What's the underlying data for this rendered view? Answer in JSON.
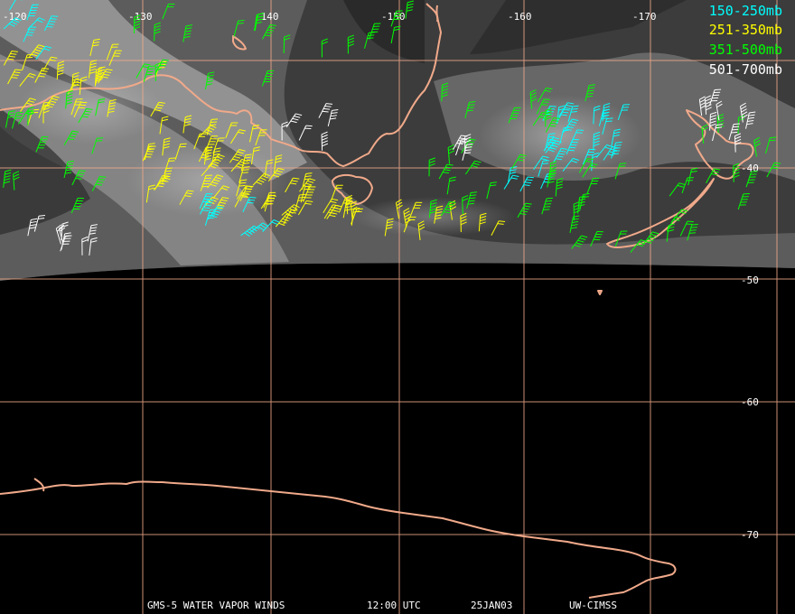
{
  "map": {
    "longitude_labels": [
      "-120",
      "-130",
      "-140",
      "-150",
      "-160",
      "-170"
    ],
    "latitude_labels": [
      "-40",
      "-50",
      "-60",
      "-70"
    ],
    "grid_color": "#f0a98a",
    "coast_color": "#f0a98a"
  },
  "legend": [
    {
      "label": "150-250mb",
      "color": "#00ffff"
    },
    {
      "label": "251-350mb",
      "color": "#ffff00"
    },
    {
      "label": "351-500mb",
      "color": "#00ff00"
    },
    {
      "label": "501-700mb",
      "color": "#ffffff"
    }
  ],
  "footer": {
    "product": "GMS-5 WATER VAPOR WINDS",
    "time": "12:00 UTC",
    "date": "25JAN03",
    "source": "UW-CIMSS"
  }
}
